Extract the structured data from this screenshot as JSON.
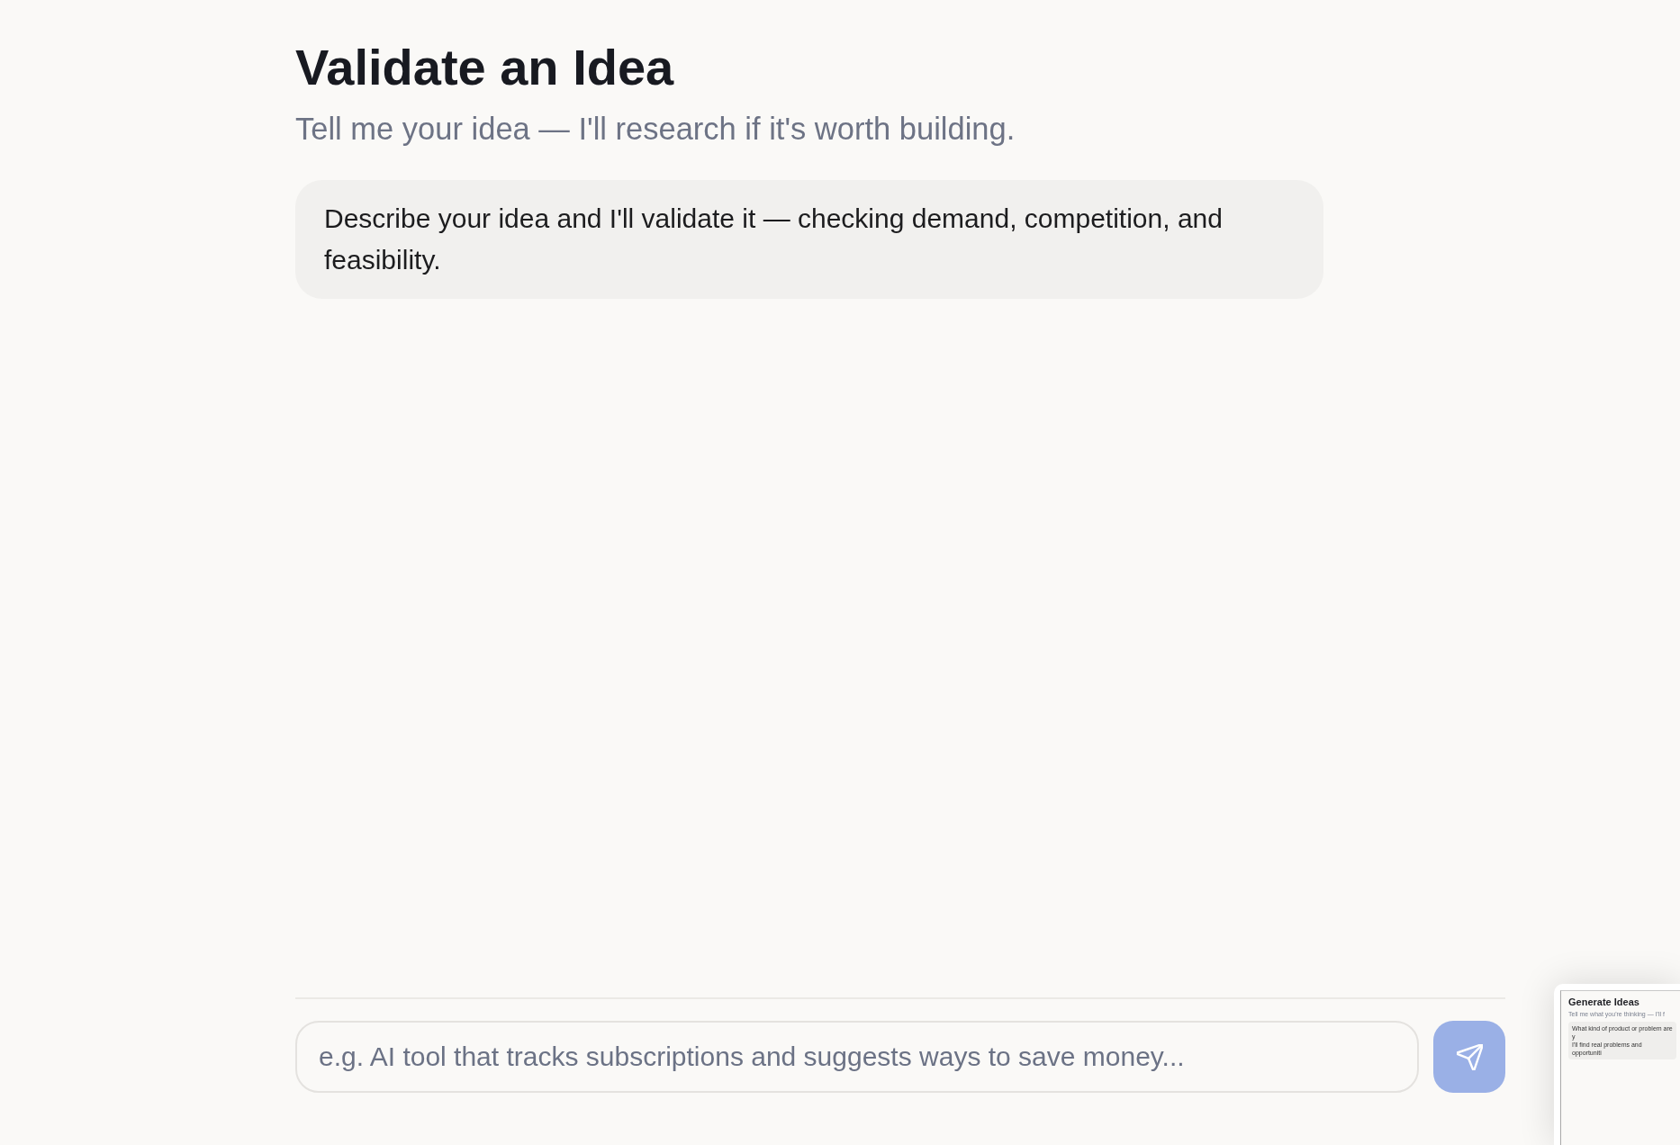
{
  "header": {
    "title": "Validate an Idea",
    "subtitle": "Tell me your idea — I'll research if it's worth building."
  },
  "messages": [
    {
      "text": "Describe your idea and I'll validate it — checking demand, competition, and feasibility."
    }
  ],
  "composer": {
    "placeholder": "e.g. AI tool that tracks subscriptions and suggests ways to save money...",
    "send_disabled": true
  },
  "screenshot_thumbnail": {
    "title": "Generate Ideas",
    "subtitle": "Tell me what you're thinking — I'll f",
    "message_lines": [
      "What kind of product or problem are y",
      "I'll find real problems and opportuniti"
    ]
  }
}
